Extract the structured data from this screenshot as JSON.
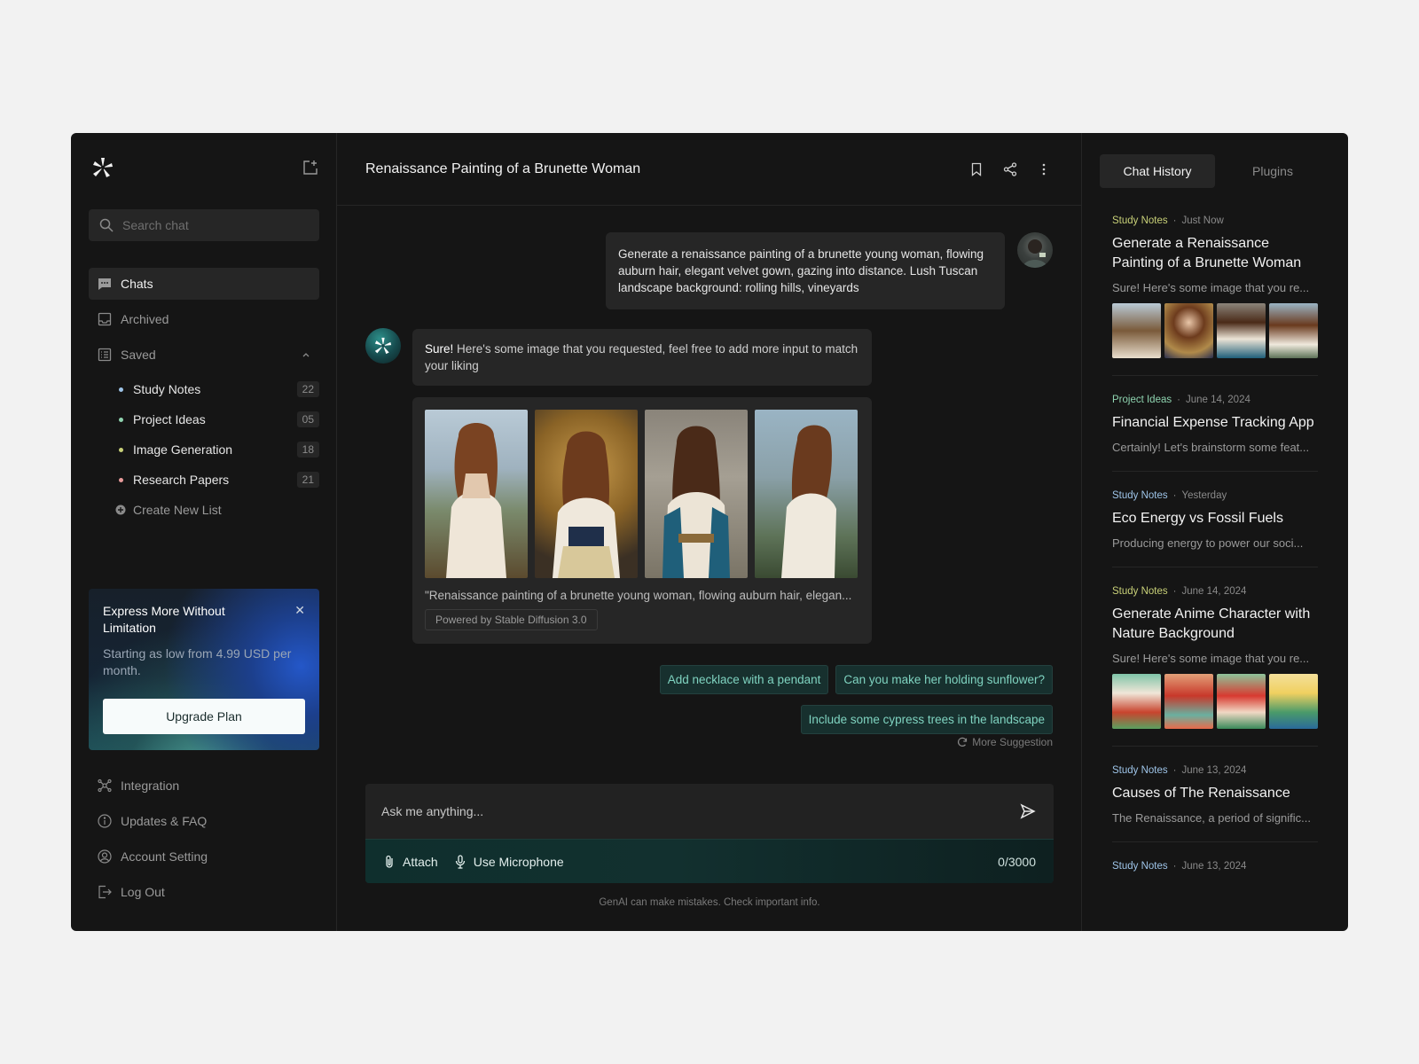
{
  "sidebar": {
    "search_placeholder": "Search chat",
    "nav": [
      {
        "label": "Chats",
        "icon": "chat-icon",
        "active": true
      },
      {
        "label": "Archived",
        "icon": "archive-icon"
      },
      {
        "label": "Saved",
        "icon": "list-icon"
      }
    ],
    "saved_lists": [
      {
        "label": "Study Notes",
        "count": "22",
        "color": "#9ec4e8"
      },
      {
        "label": "Project Ideas",
        "count": "05",
        "color": "#8fd4b0"
      },
      {
        "label": "Image Generation",
        "count": "18",
        "color": "#c8d078"
      },
      {
        "label": "Research Papers",
        "count": "21",
        "color": "#e89a9a"
      }
    ],
    "create_list": "Create New List",
    "promo": {
      "title": "Express More Without Limitation",
      "subtitle": "Starting as low from 4.99 USD per month.",
      "button": "Upgrade Plan"
    },
    "bottom_nav": [
      {
        "label": "Integration",
        "icon": "integration-icon"
      },
      {
        "label": "Updates & FAQ",
        "icon": "info-icon"
      },
      {
        "label": "Account Setting",
        "icon": "account-icon"
      },
      {
        "label": "Log Out",
        "icon": "logout-icon"
      }
    ]
  },
  "main": {
    "title": "Renaissance Painting of a Brunette Woman",
    "user_message": "Generate a renaissance painting of a brunette young woman, flowing auburn hair, elegant velvet gown, gazing into distance. Lush Tuscan landscape background: rolling hills, vineyards",
    "bot_reply_strong": "Sure!",
    "bot_reply": " Here's some image that you requested, feel free to add more input to match your liking",
    "caption": "\"Renaissance painting of a brunette young woman, flowing auburn hair, elegan...",
    "powered_by": "Powered by Stable Diffusion 3.0",
    "suggestions": [
      "Add necklace with a pendant",
      "Can you make her holding sunflower?",
      "Include some cypress trees in the landscape"
    ],
    "more_suggestion": "More Suggestion",
    "input_placeholder": "Ask me anything...",
    "attach": "Attach",
    "microphone": "Use Microphone",
    "counter": "0/3000",
    "disclaimer": "GenAI can make mistakes. Check important info."
  },
  "right": {
    "tabs": [
      {
        "label": "Chat History",
        "active": true
      },
      {
        "label": "Plugins"
      }
    ],
    "history": [
      {
        "category": "Study Notes",
        "time": "Just Now",
        "title": "Generate a Renaissance Painting of a Brunette Woman",
        "preview": "Sure! Here's some image that you re...",
        "thumbs": "renaissance"
      },
      {
        "category": "Project Ideas",
        "time": "June 14, 2024",
        "title": "Financial Expense Tracking App",
        "preview": "Certainly! Let's brainstorm some feat..."
      },
      {
        "category": "Study Notes",
        "time": "Yesterday",
        "title": "Eco Energy vs Fossil Fuels",
        "preview": "Producing energy to power our soci..."
      },
      {
        "category": "Study Notes",
        "time": "June 14, 2024",
        "title": "Generate Anime Character with Nature Background",
        "preview": "Sure! Here's some image that you re...",
        "thumbs": "anime"
      },
      {
        "category": "Study Notes",
        "time": "June 13, 2024",
        "title": "Causes of The Renaissance",
        "preview": "The Renaissance, a period of signific..."
      },
      {
        "category": "Study Notes",
        "time": "June 13, 2024",
        "title": "",
        "preview": ""
      }
    ]
  }
}
